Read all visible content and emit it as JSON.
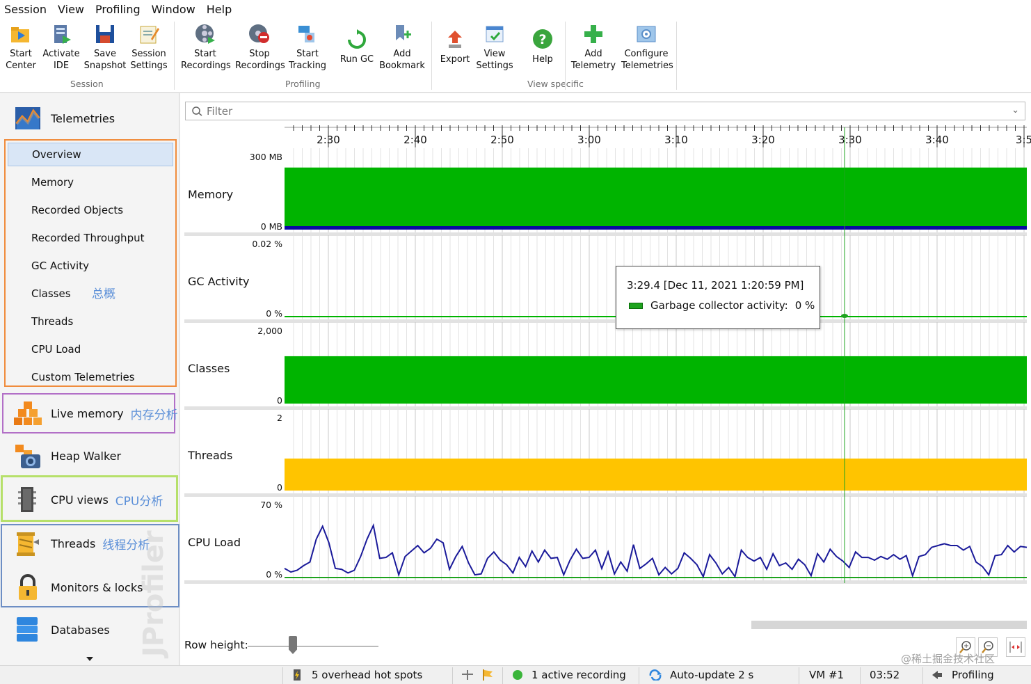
{
  "menu": [
    "Session",
    "View",
    "Profiling",
    "Window",
    "Help"
  ],
  "toolbar": {
    "buttons": [
      {
        "label": "Start\nCenter",
        "icon": "start-center-icon"
      },
      {
        "label": "Activate\nIDE",
        "icon": "activate-ide-icon"
      },
      {
        "label": "Save\nSnapshot",
        "icon": "save-snapshot-icon"
      },
      {
        "label": "Session\nSettings",
        "icon": "session-settings-icon"
      },
      {
        "label": "Start\nRecordings",
        "icon": "start-recordings-icon"
      },
      {
        "label": "Stop\nRecordings",
        "icon": "stop-recordings-icon"
      },
      {
        "label": "Start\nTracking",
        "icon": "start-tracking-icon"
      },
      {
        "label": "Run GC",
        "icon": "run-gc-icon"
      },
      {
        "label": "Add\nBookmark",
        "icon": "add-bookmark-icon"
      },
      {
        "label": "Export",
        "icon": "export-icon"
      },
      {
        "label": "View\nSettings",
        "icon": "view-settings-icon"
      },
      {
        "label": "Help",
        "icon": "help-icon"
      },
      {
        "label": "Add\nTelemetry",
        "icon": "add-telemetry-icon"
      },
      {
        "label": "Configure\nTelemetries",
        "icon": "configure-telemetries-icon"
      }
    ],
    "groups": [
      "Session",
      "Profiling",
      "View specific"
    ]
  },
  "sidebar": {
    "telemetries": "Telemetries",
    "sub_items": [
      "Overview",
      "Memory",
      "Recorded Objects",
      "Recorded Throughput",
      "GC Activity",
      "Classes",
      "Threads",
      "CPU Load",
      "Custom Telemetries"
    ],
    "selected": "Overview",
    "overview_annotation": "总概",
    "live_memory": "Live memory",
    "live_memory_annotation": "内存分析",
    "heap_walker": "Heap Walker",
    "cpu_views": "CPU views",
    "cpu_annotation": "CPU分析",
    "threads": "Threads",
    "threads_annotation": "线程分析",
    "monitors": "Monitors & locks",
    "databases": "Databases",
    "watermark": "JProfiler"
  },
  "filter": {
    "placeholder": "Filter"
  },
  "chart_data": {
    "type": "line",
    "time_ticks": [
      "2:30",
      "2:40",
      "2:50",
      "3:00",
      "3:10",
      "3:20",
      "3:30",
      "3:40",
      "3:5"
    ],
    "rows": [
      {
        "name": "Memory",
        "ymax": "300 MB",
        "ymin": "0 MB",
        "kind": "area",
        "color": "#00b400",
        "fill_level": 0.97,
        "baseline_color": "#0a0aa0"
      },
      {
        "name": "GC Activity",
        "ymax": "0.02 %",
        "ymin": "0 %",
        "kind": "flat",
        "color": "#00b400",
        "fill_level": 0.0
      },
      {
        "name": "Classes",
        "ymax": "2,000",
        "ymin": "0",
        "kind": "area",
        "color": "#00b400",
        "fill_level": 0.74
      },
      {
        "name": "Threads",
        "ymax": "2",
        "ymin": "0",
        "kind": "area",
        "color": "#ffc400",
        "fill_level": 0.5
      },
      {
        "name": "CPU Load",
        "ymax": "70 %",
        "ymin": "0 %",
        "kind": "line",
        "color": "#1a1a9a",
        "values": [
          10,
          6,
          8,
          13,
          17,
          42,
          56,
          38,
          10,
          9,
          5,
          8,
          23,
          42,
          57,
          21,
          22,
          27,
          3,
          23,
          29,
          35,
          27,
          32,
          42,
          38,
          9,
          23,
          34,
          16,
          3,
          4,
          21,
          28,
          19,
          14,
          5,
          22,
          12,
          29,
          17,
          30,
          21,
          22,
          3,
          19,
          31,
          21,
          22,
          30,
          10,
          28,
          4,
          17,
          7,
          36,
          10,
          15,
          21,
          3,
          11,
          4,
          10,
          27,
          21,
          14,
          1,
          25,
          16,
          4,
          11,
          1,
          30,
          22,
          18,
          22,
          9,
          26,
          13,
          16,
          9,
          20,
          14,
          2,
          26,
          17,
          31,
          23,
          18,
          11,
          28,
          22,
          22,
          19,
          23,
          20,
          25,
          20,
          24,
          2,
          23,
          25,
          33,
          35,
          37,
          35,
          35,
          30,
          34,
          17,
          12,
          3,
          24,
          25,
          35,
          28,
          34,
          33
        ]
      }
    ],
    "cursor_time": "3:29.4"
  },
  "tooltip": {
    "time": "3:29.4 [Dec 11, 2021 1:20:59 PM]",
    "series": "Garbage collector activity:",
    "value": "0 %"
  },
  "row_height_label": "Row height:",
  "status": {
    "hotspots": "5 overhead hot spots",
    "recording": "1 active recording",
    "autoupdate": "Auto-update 2 s",
    "vm": "VM #1",
    "time": "03:52",
    "mode": "Profiling"
  },
  "credit": "@稀土掘金技术社区",
  "colors": {
    "accent": "#5b8fd8",
    "orange_box": "#f08c3c",
    "purple_box": "#b26fc7",
    "green_box": "#b6e06a",
    "blue_box": "#6d8ec4"
  }
}
